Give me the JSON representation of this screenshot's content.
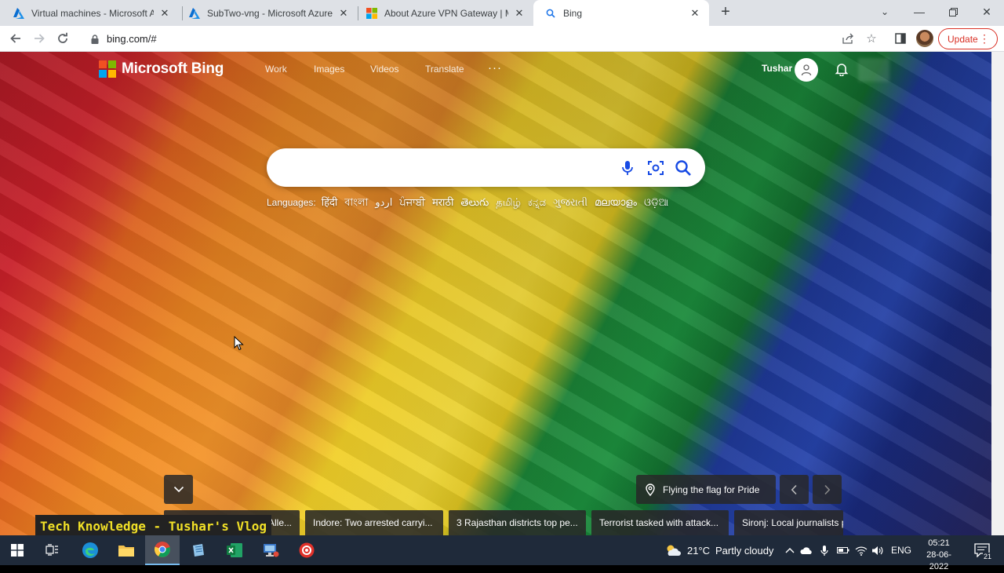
{
  "browser": {
    "tabs": [
      {
        "title": "Virtual machines - Microsoft Azure",
        "favicon": "azure-icon",
        "active": false
      },
      {
        "title": "SubTwo-vng - Microsoft Azure",
        "favicon": "azure-icon",
        "active": false
      },
      {
        "title": "About Azure VPN Gateway | Microsoft",
        "favicon": "microsoft-icon",
        "active": false
      },
      {
        "title": "Bing",
        "favicon": "search-icon",
        "active": true
      }
    ],
    "url": "bing.com/#",
    "update_label": "Update",
    "update_color": "#d93025"
  },
  "bing": {
    "logo_text": "Microsoft Bing",
    "nav": [
      "Work",
      "Images",
      "Videos",
      "Translate"
    ],
    "nav_more": "···",
    "user_name": "Tushar",
    "search_placeholder": "",
    "languages_label": "Languages:",
    "languages": [
      "हिंदी",
      "বাংলা",
      "اردو",
      "ਪੰਜਾਬੀ",
      "मराठी",
      "తెలుగు",
      "தமிழ்",
      "ಕನ್ನಡ",
      "ગુજરાતી",
      "മലയാളം",
      "ଓଡ଼ିଆ"
    ],
    "image_caption": "Flying the flag for Pride",
    "news": [
      "Alle...",
      "Indore: Two arrested carryi...",
      "3 Rajasthan districts top pe...",
      "Terrorist tasked with attack...",
      "Sironj: Local journalists p"
    ]
  },
  "watermark": "Tech Knowledge - Tushar's Vlog",
  "taskbar": {
    "weather_temp": "21°C",
    "weather_text": "Partly cloudy",
    "language": "ENG",
    "time": "05:21",
    "date": "28-06-2022",
    "notification_count": "21"
  }
}
